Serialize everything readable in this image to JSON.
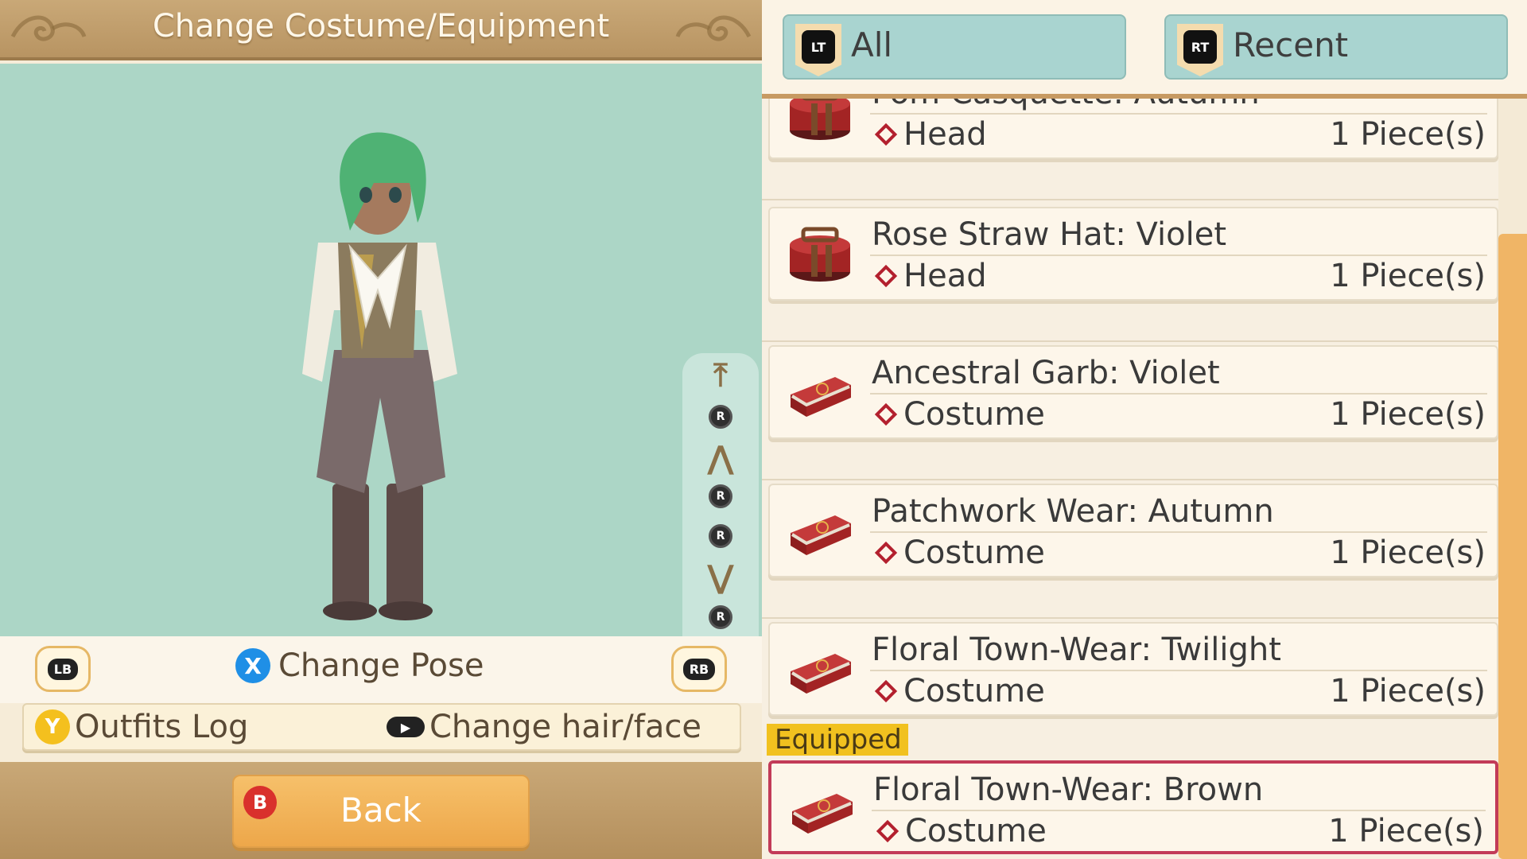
{
  "header": {
    "title": "Change Costume/Equipment"
  },
  "camera_controls": {
    "top": "⤒",
    "stick_up": "R",
    "up": "⋀",
    "stick_left": "R",
    "stick_right": "R",
    "down": "⋁",
    "stick_down": "R",
    "bottom": "⤓"
  },
  "pose_row": {
    "lb": "LB",
    "rb": "RB",
    "x_button": "X",
    "change_pose": "Change Pose"
  },
  "log_row": {
    "y_button": "Y",
    "outfits_log": "Outfits Log",
    "stick_label": "▶",
    "change_hair_face": "Change hair/face"
  },
  "footer": {
    "b_button": "B",
    "back": "Back"
  },
  "tabs": [
    {
      "badge": "LT",
      "label": "All"
    },
    {
      "badge": "RT",
      "label": "Recent"
    }
  ],
  "items": [
    {
      "name": "Pom Casquette: Autumn",
      "category": "Head",
      "qty": "1 Piece(s)",
      "icon": "hatbox-icon"
    },
    {
      "name": "Rose Straw Hat: Violet",
      "category": "Head",
      "qty": "1 Piece(s)",
      "icon": "hatbox-icon"
    },
    {
      "name": "Ancestral Garb: Violet",
      "category": "Costume",
      "qty": "1 Piece(s)",
      "icon": "clothes-case-icon"
    },
    {
      "name": "Patchwork Wear: Autumn",
      "category": "Costume",
      "qty": "1 Piece(s)",
      "icon": "clothes-case-icon"
    },
    {
      "name": "Floral Town-Wear: Twilight",
      "category": "Costume",
      "qty": "1 Piece(s)",
      "icon": "clothes-case-icon"
    }
  ],
  "equipped": {
    "tag": "Equipped",
    "item": {
      "name": "Floral Town-Wear: Brown",
      "category": "Costume",
      "qty": "1 Piece(s)",
      "icon": "clothes-case-icon"
    }
  },
  "colors": {
    "accent_gold": "#c9a877",
    "stage_bg": "#acd6c6",
    "equipped_border": "#c23b58",
    "equipped_tag": "#f1c11f"
  }
}
